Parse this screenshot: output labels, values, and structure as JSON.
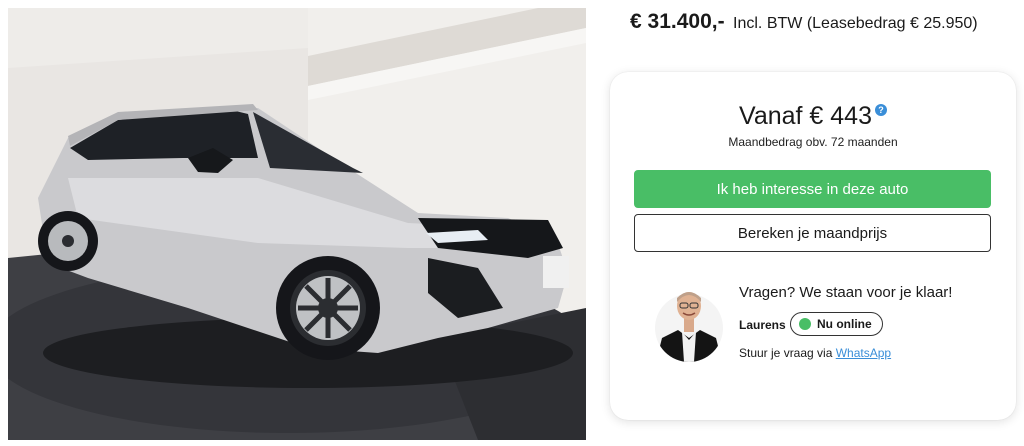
{
  "listing": {
    "price": "€ 31.400,-",
    "price_note": "Incl. BTW (Leasebedrag € 25.950)"
  },
  "finance": {
    "monthly": "Vanaf € 443",
    "help_symbol": "?",
    "monthly_sub": "Maandbedrag obv. 72 maanden"
  },
  "actions": {
    "interest": "Ik heb interesse in deze auto",
    "calculate": "Bereken je maandprijs"
  },
  "contact": {
    "title": "Vragen? We staan voor je klaar!",
    "name": "Laurens",
    "status": "Nu online",
    "prompt": "Stuur je vraag via",
    "channel": "WhatsApp"
  },
  "colors": {
    "accent_green": "#49be66",
    "link_blue": "#3a8ed8"
  },
  "icons": {
    "help": "question-circle-icon",
    "status": "online-dot-icon"
  }
}
